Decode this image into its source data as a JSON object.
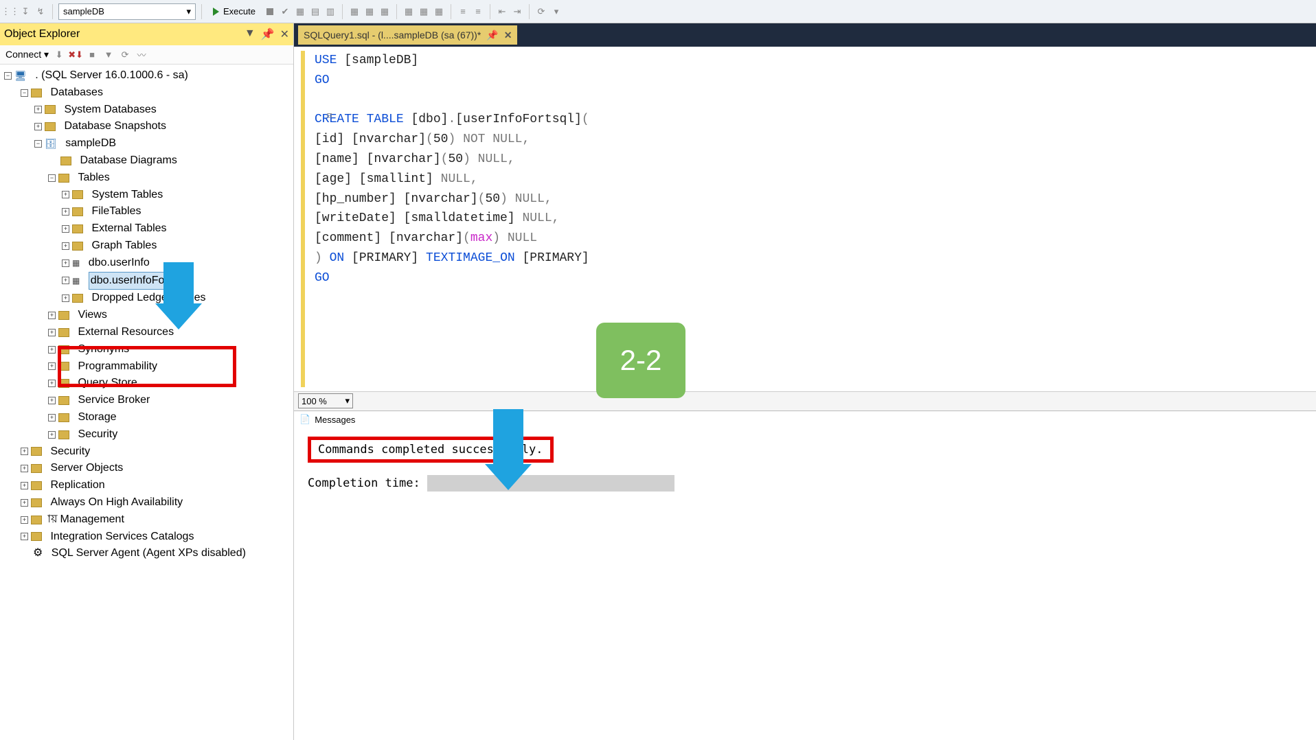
{
  "toolbar": {
    "db_selected": "sampleDB",
    "execute_label": "Execute"
  },
  "objectExplorer": {
    "title": "Object Explorer",
    "connect_label": "Connect",
    "root": ". (SQL Server 16.0.1000.6 - sa)",
    "databases": "Databases",
    "sys_db": "System Databases",
    "db_snapshots": "Database Snapshots",
    "sampleDB": "sampleDB",
    "db_diagrams": "Database Diagrams",
    "tables": "Tables",
    "sys_tables": "System Tables",
    "file_tables": "FileTables",
    "ext_tables": "External Tables",
    "graph_tables": "Graph Tables",
    "table_userInfo": "dbo.userInfo",
    "table_userInfoFortsql": "dbo.userInfoFortsql",
    "dropped_ledger": "Dropped Ledger Tables",
    "views": "Views",
    "ext_resources": "External Resources",
    "synonyms": "Synonyms",
    "programmability": "Programmability",
    "query_store": "Query Store",
    "service_broker": "Service Broker",
    "storage": "Storage",
    "security_node": "Security",
    "top_security": "Security",
    "server_objects": "Server Objects",
    "replication": "Replication",
    "always_on": "Always On High Availability",
    "management": "Management",
    "integration": "Integration Services Catalogs",
    "agent": "SQL Server Agent (Agent XPs disabled)"
  },
  "tab": {
    "title": "SQLQuery1.sql - (l....sampleDB (sa (67))*"
  },
  "sql": {
    "l1a": "USE ",
    "l1b": "[sampleDB]",
    "l2": "GO",
    "l3a": "CREATE TABLE ",
    "l3b": "[dbo]",
    "l3c": ".",
    "l3d": "[userInfoFortsql]",
    "l3e": "(",
    "l4a": "    [id] [nvarchar]",
    "l4b": "(",
    "l4c": "50",
    "l4d": ") ",
    "l4e": "NOT NULL",
    "l4f": ",",
    "l5a": "    [name] [nvarchar]",
    "l5b": "(",
    "l5c": "50",
    "l5d": ") ",
    "l5e": "NULL",
    "l5f": ",",
    "l6a": "    [age] [smallint] ",
    "l6b": "NULL",
    "l6c": ",",
    "l7a": "    [hp_number] [nvarchar]",
    "l7b": "(",
    "l7c": "50",
    "l7d": ") ",
    "l7e": "NULL",
    "l7f": ",",
    "l8a": "    [writeDate] [smalldatetime] ",
    "l8b": "NULL",
    "l8c": ",",
    "l9a": "    [comment] [nvarchar]",
    "l9b": "(",
    "l9c": "max",
    "l9d": ") ",
    "l9e": "NULL",
    "l10a": ") ",
    "l10b": "ON ",
    "l10c": "[PRIMARY] ",
    "l10d": "TEXTIMAGE_ON ",
    "l10e": "[PRIMARY]",
    "l11": "GO"
  },
  "zoom": {
    "value": "100 %"
  },
  "messages": {
    "tab_label": "Messages",
    "success": "Commands completed successfully.",
    "completion": "Completion time:"
  },
  "annotation": {
    "badge": "2-2"
  }
}
